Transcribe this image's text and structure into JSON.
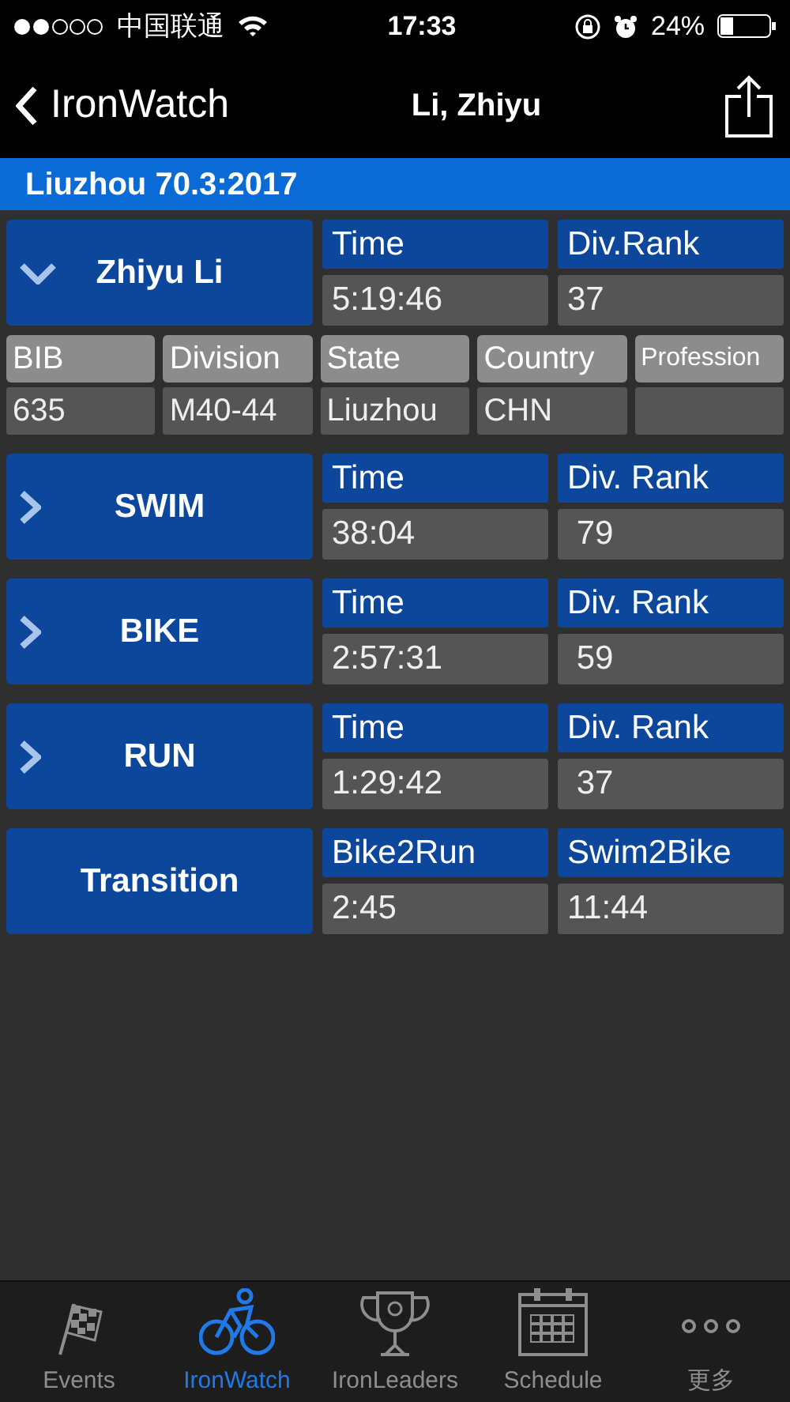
{
  "status_bar": {
    "carrier": "中国联通",
    "time": "17:33",
    "battery": "24%"
  },
  "nav": {
    "back": "IronWatch",
    "title": "Li, Zhiyu"
  },
  "event": "Liuzhou 70.3:2017",
  "athlete": {
    "name": "Zhiyu Li",
    "expanded": true,
    "stats": [
      {
        "label": "Time",
        "value": "5:19:46"
      },
      {
        "label": "Div.Rank",
        "value": "37"
      }
    ]
  },
  "info": [
    {
      "label": "BIB",
      "value": "635"
    },
    {
      "label": "Division",
      "value": "M40-44"
    },
    {
      "label": "State",
      "value": "Liuzhou"
    },
    {
      "label": "Country",
      "value": "CHN"
    },
    {
      "label": "Profession"
    }
  ],
  "segments": [
    {
      "name": "SWIM",
      "kind": "expandable",
      "expanded": false,
      "stats": [
        {
          "label": "Time",
          "value": "38:04"
        },
        {
          "label": "Div. Rank",
          "value": " 79"
        }
      ]
    },
    {
      "name": "BIKE",
      "kind": "expandable",
      "expanded": false,
      "stats": [
        {
          "label": "Time",
          "value": "2:57:31"
        },
        {
          "label": "Div. Rank",
          "value": " 59"
        }
      ]
    },
    {
      "name": "RUN",
      "kind": "expandable",
      "expanded": false,
      "stats": [
        {
          "label": "Time",
          "value": "1:29:42"
        },
        {
          "label": "Div. Rank",
          "value": " 37"
        }
      ]
    },
    {
      "name": "Transition",
      "kind": "plain",
      "stats": [
        {
          "label": "Bike2Run",
          "value": "2:45"
        },
        {
          "label": "Swim2Bike",
          "value": "11:44"
        }
      ]
    }
  ],
  "tabs": [
    {
      "label": "Events",
      "kind": "flag",
      "selected": false
    },
    {
      "label": "IronWatch",
      "kind": "bike",
      "selected": true
    },
    {
      "label": "IronLeaders",
      "kind": "trophy",
      "selected": false
    },
    {
      "label": "Schedule",
      "kind": "calendar",
      "selected": false
    },
    {
      "label": "更多",
      "kind": "more",
      "selected": false
    }
  ]
}
